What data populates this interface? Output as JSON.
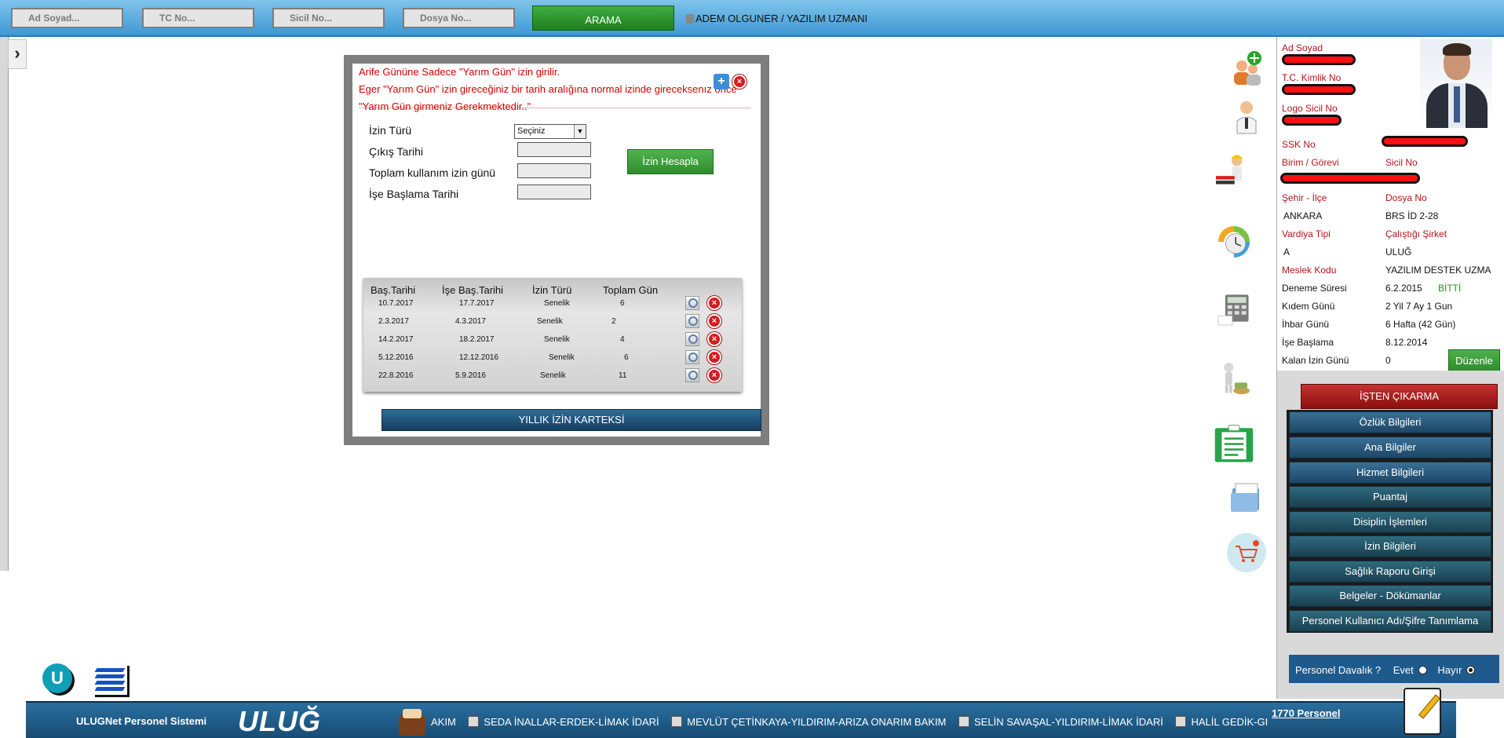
{
  "topbar": {
    "search_fields": [
      "Ad Soyad...",
      "TC No...",
      "Sicil No...",
      "Dosya No..."
    ],
    "search_button": "ARAMA",
    "user_title": "ADEM OLGUNER / YAZILIM UZMANI"
  },
  "dialog": {
    "warning_lines": [
      "Arife Gününe Sadece \"Yarım Gün\" izin girilir.",
      "Eger \"Yarım Gün\" izin gireceğiniz bir tarih aralığına normal izinde gireceksenız önce",
      "\"Yarım Gün girmeniz Gerekmektedir..\""
    ],
    "form": {
      "leave_type_label": "İzin Türü",
      "leave_type_value": "Seçiniz",
      "exit_date_label": "Çıkış Tarihi",
      "total_days_label": "Toplam kullanım izin günü",
      "return_date_label": "İşe Başlama Tarihi"
    },
    "calculate_button": "İzin Hesapla",
    "table": {
      "headers": [
        "Baş.Tarihi",
        "İşe Baş.Tarihi",
        "İzin Türü",
        "Toplam Gün"
      ],
      "rows": [
        [
          "10.7.2017",
          "17.7.2017",
          "Senelik",
          "6"
        ],
        [
          "2.3.2017",
          "4.3.2017",
          "Senelik",
          "2"
        ],
        [
          "14.2.2017",
          "18.2.2017",
          "Senelik",
          "4"
        ],
        [
          "5.12.2016",
          "12.12.2016",
          "Senelik",
          "6"
        ],
        [
          "22.8.2016",
          "5.9.2016",
          "Senelik",
          "11"
        ]
      ]
    },
    "card_button": "YILLIK İZİN KARTEKSİ"
  },
  "side_icons": [
    "add-user-icon",
    "doctor-icon",
    "construction-worker-icon",
    "clock-icon",
    "calculator-icon",
    "person-with-money-icon",
    "clipboard-icon",
    "folder-icon",
    "cart-icon"
  ],
  "profile": {
    "ad_soyad_label": "Ad Soyad",
    "tc_label": "T.C. Kimlik No",
    "logo_sicil_label": "Logo Sicil No",
    "ssk_label": "SSK No",
    "birim_label": "Birim / Görevi",
    "sicil_label": "Sicil No",
    "sehir_label": "Şehir - İlçe",
    "sehir_value": "ANKARA",
    "dosya_label": "Dosya No",
    "dosya_value": "BRS İD 2-28",
    "vardiya_label": "Vardiya Tipi",
    "vardiya_value": "A",
    "sirket_label": "Çalıştığı Şirket",
    "sirket_value": "ULUĞ",
    "meslek_label": "Meslek Kodu",
    "meslek_value": "YAZILIM DESTEK UZMA",
    "deneme_label": "Deneme Süresi",
    "deneme_value": "6.2.2015",
    "deneme_status": "BİTTİ",
    "kidem_label": "Kıdem Günü",
    "kidem_value": "2 Yil 7 Ay 1 Gun",
    "ihbar_label": "İhbar Günü",
    "ihbar_value": "6 Hafta (42 Gün)",
    "ise_baslama_label": "İşe Başlama",
    "ise_baslama_value": "8.12.2014",
    "kalan_label": "Kalan İzin Günü",
    "kalan_value": "0",
    "edit_button": "Düzenle"
  },
  "menu": {
    "fire_button": "İŞTEN ÇIKARMA",
    "items": [
      "Özlük Bilgileri",
      "Ana Bilgiler",
      "Hizmet Bilgileri",
      "Puantaj",
      "Disiplin İşlemleri",
      "İzin Bilgileri",
      "Sağlık Raporu Girişi",
      "Belgeler - Dökümanlar",
      "Personel Kullanıcı Adı/Şifre Tanımlama"
    ],
    "lawsuit_label": "Personel Davalık ?",
    "yes_label": "Evet",
    "no_label": "Hayır"
  },
  "bottombar": {
    "system_name": "ULUGNet Personel Sistemi",
    "logo_text": "ULUĞ",
    "ticker": [
      "AKIM",
      "SEDA İNALLAR-ERDEK-LİMAK İDARİ",
      "MEVLÜT ÇETİNKAYA-YILDIRIM-ARIZA ONARIM BAKIM",
      "SELİN SAVAŞAL-YILDIRIM-LİMAK İDARİ",
      "HALİL GEDİK-GI"
    ],
    "personnel_count": "1770 Personel"
  },
  "colors": {
    "accent_blue": "#1f5a8c",
    "alert_red": "#d40000",
    "success_green": "#2f8c2d"
  }
}
